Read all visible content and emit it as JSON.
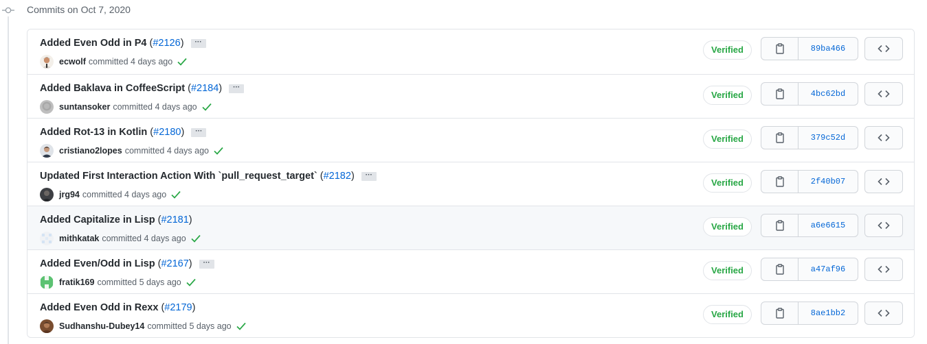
{
  "group": {
    "title": "Commits on Oct 7, 2020"
  },
  "verified_label": "Verified",
  "icons": {
    "commit_node": "git-commit-icon",
    "copy": "clipboard-icon",
    "browse": "code-icon",
    "check": "check-icon",
    "more": "ellipsis-icon"
  },
  "colors": {
    "link": "#0366d6",
    "verified": "#28a745",
    "hover_row": "#f6f8fa"
  },
  "commits": [
    {
      "message": "Added Even Odd in P4",
      "pr": "#2126",
      "has_more": true,
      "author": "ecwolf",
      "meta": "committed 4 days ago",
      "sha": "89ba466",
      "avatar": "person-photo"
    },
    {
      "message": "Added Baklava in CoffeeScript",
      "pr": "#2184",
      "has_more": true,
      "author": "suntansoker",
      "meta": "committed 4 days ago",
      "sha": "4bc62bd",
      "avatar": "grey-photo"
    },
    {
      "message": "Added Rot-13 in Kotlin",
      "pr": "#2180",
      "has_more": true,
      "author": "cristiano2lopes",
      "meta": "committed 4 days ago",
      "sha": "379c52d",
      "avatar": "person-photo-dark"
    },
    {
      "message": "Updated First Interaction Action With `pull_request_target`",
      "pr": "#2182",
      "has_more": true,
      "author": "jrg94",
      "meta": "committed 4 days ago",
      "sha": "2f40b07",
      "avatar": "dark-photo"
    },
    {
      "message": "Added Capitalize in Lisp",
      "pr": "#2181",
      "has_more": false,
      "author": "mithkatak",
      "meta": "committed 4 days ago",
      "sha": "a6e6615",
      "avatar": "cloud-identicon"
    },
    {
      "message": "Added Even/Odd in Lisp",
      "pr": "#2167",
      "has_more": true,
      "author": "fratik169",
      "meta": "committed 5 days ago",
      "sha": "a47af96",
      "avatar": "green-identicon"
    },
    {
      "message": "Added Even Odd in Rexx",
      "pr": "#2179",
      "has_more": false,
      "author": "Sudhanshu-Dubey14",
      "meta": "committed 5 days ago",
      "sha": "8ae1bb2",
      "avatar": "brown-photo"
    }
  ]
}
